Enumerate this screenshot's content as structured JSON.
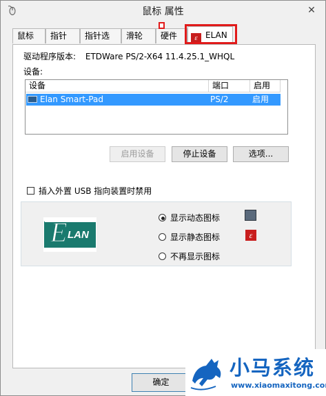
{
  "window": {
    "title": "鼠标 属性",
    "close_glyph": "✕"
  },
  "tabs": [
    {
      "label": "鼠标键"
    },
    {
      "label": "指针"
    },
    {
      "label": "指针选项"
    },
    {
      "label": "滑轮"
    },
    {
      "label": "硬件"
    },
    {
      "label": "ELAN",
      "active": true
    }
  ],
  "driver": {
    "label": "驱动程序版本:",
    "value": "ETDWare PS/2-X64 11.4.25.1_WHQL"
  },
  "devices": {
    "label": "设备:",
    "columns": [
      "设备",
      "端口",
      "启用"
    ],
    "rows": [
      {
        "device": "Elan Smart-Pad",
        "port": "PS/2",
        "enabled": "启用",
        "selected": true
      }
    ]
  },
  "buttons": {
    "enable_device": "启用设备",
    "stop_device": "停止设备",
    "options": "选项..."
  },
  "checkbox": {
    "label": "插入外置 USB 指向装置时禁用",
    "checked": false
  },
  "tray_icon": {
    "options": [
      {
        "label": "显示动态图标",
        "checked": true,
        "icon": "touchpad-tray-icon"
      },
      {
        "label": "显示静态图标",
        "checked": false,
        "icon": "elan-red-icon"
      },
      {
        "label": "不再显示图标",
        "checked": false
      }
    ]
  },
  "logo": {
    "text": "LAN",
    "initial": "E"
  },
  "footer": {
    "ok": "确定"
  },
  "watermark": {
    "name": "小马系统",
    "url": "www.xiaomaxitong.com"
  },
  "colors": {
    "accent_red": "#e11a1a",
    "selection_blue": "#3399ff",
    "elan_teal": "#1a7a6e",
    "watermark_blue": "#1565c0"
  }
}
